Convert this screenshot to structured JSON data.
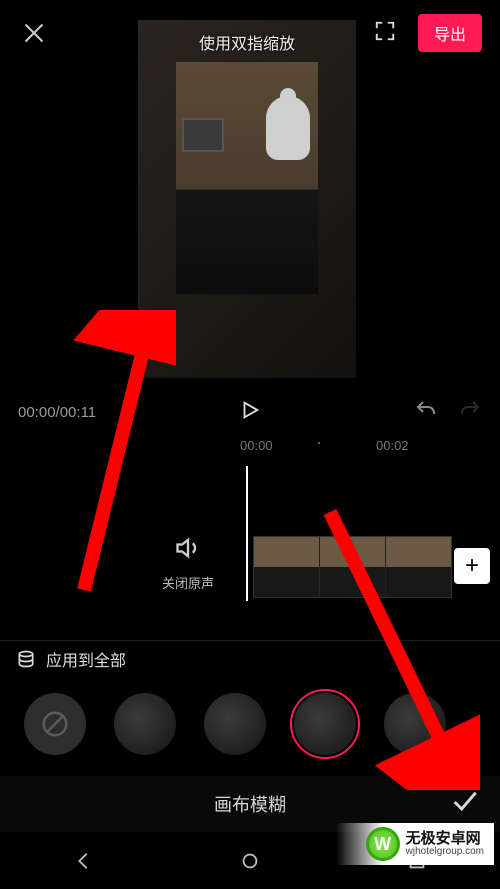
{
  "colors": {
    "accent": "#ff1a53"
  },
  "topbar": {
    "export_label": "导出"
  },
  "preview": {
    "pinch_hint": "使用双指缩放"
  },
  "playbar": {
    "current_time": "00:00",
    "total_time": "00:11"
  },
  "ruler": {
    "t0": "00:00",
    "t2": "00:02"
  },
  "mute": {
    "label": "关闭原声"
  },
  "apply_all": {
    "label": "应用到全部"
  },
  "blur_options": {
    "items": [
      "none",
      "blur-1",
      "blur-2",
      "blur-3",
      "blur-4"
    ],
    "selected_index": 3
  },
  "footer": {
    "title": "画布模糊"
  },
  "watermark": {
    "brand": "无极安卓网",
    "domain": "wjhotelgroup.com"
  }
}
